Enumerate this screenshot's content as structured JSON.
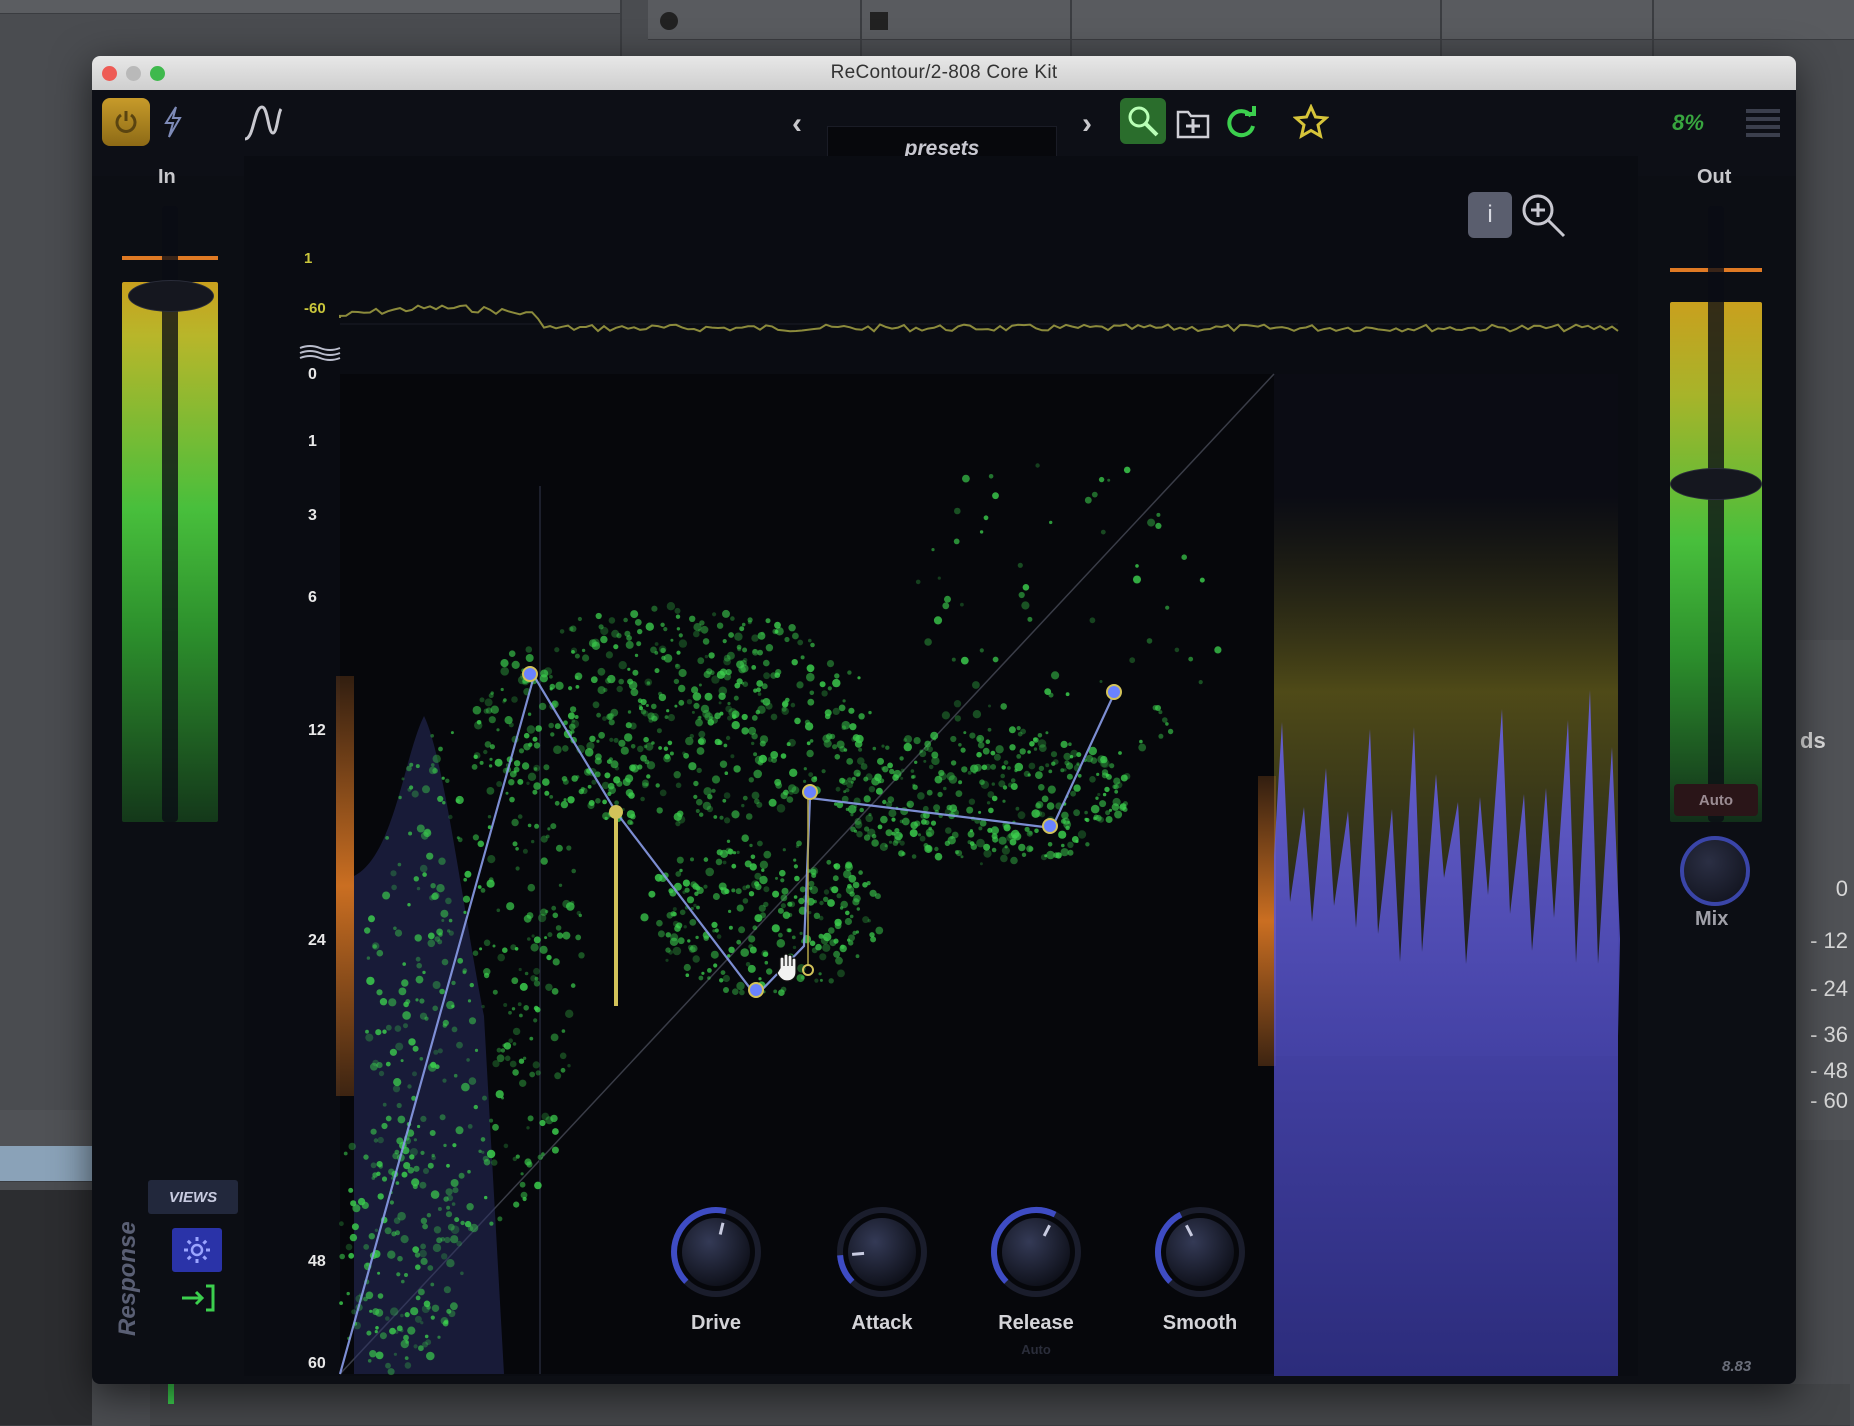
{
  "window": {
    "title": "ReContour/2-808 Core Kit"
  },
  "toolbar": {
    "preset_label": "presets",
    "prev_arrow": "‹",
    "next_arrow": "›",
    "cpu": "8%",
    "icons": [
      "power-icon",
      "bolt-icon",
      "curve-icon",
      "search-icon",
      "add-preset-icon",
      "refresh-icon",
      "star-icon",
      "menu-icon"
    ]
  },
  "input": {
    "label": "In"
  },
  "output": {
    "label": "Out",
    "auto_label": "Auto",
    "mix_label": "Mix"
  },
  "display": {
    "top_scale": [
      "1",
      "-60"
    ],
    "y_scale": [
      "0",
      "1",
      "3",
      "6",
      "12",
      "24",
      "48",
      "60"
    ],
    "info_button": "i"
  },
  "views": {
    "label": "VIEWS",
    "response_label": "Response"
  },
  "knobs": [
    {
      "name": "Drive",
      "value": 0.55
    },
    {
      "name": "Attack",
      "value": 0.15
    },
    {
      "name": "Release",
      "value": 0.6,
      "sub": "Auto"
    },
    {
      "name": "Smooth",
      "value": 0.4
    }
  ],
  "version": "8.83",
  "background_meter": [
    "0",
    "- 12",
    "- 24",
    "- 36",
    "- 48",
    "- 60"
  ],
  "background_label": "ds",
  "colors": {
    "accent_green": "#3ccf4e",
    "accent_yellow": "#c9c63b",
    "curve_blue": "#7c8fe0",
    "node_gold": "#d2c25a"
  }
}
